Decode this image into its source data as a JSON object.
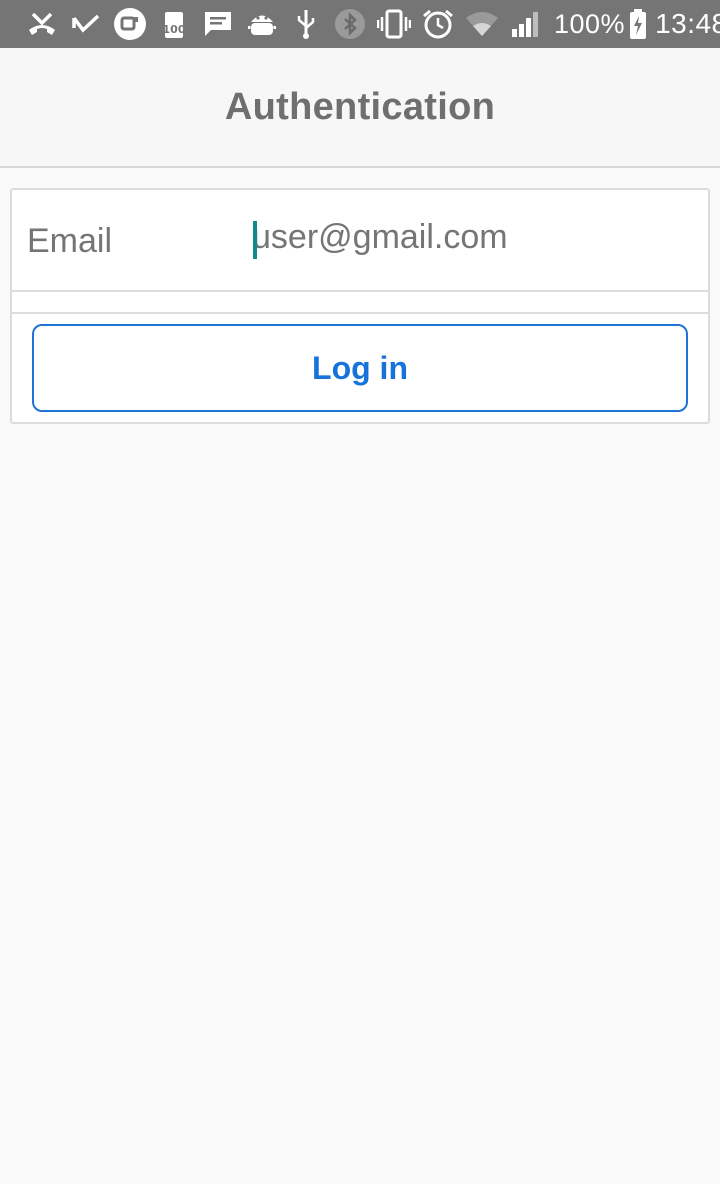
{
  "status_bar": {
    "icons": [
      "missed-call-icon",
      "call-received-icon",
      "vpn-key-icon",
      "storage-100-icon",
      "message-icon",
      "android-debug-icon",
      "usb-icon",
      "bluetooth-icon",
      "vibrate-icon",
      "alarm-icon",
      "wifi-icon",
      "cell-signal-icon"
    ],
    "battery_percent": "100%",
    "time": "13:48"
  },
  "header": {
    "title": "Authentication"
  },
  "form": {
    "email_label": "Email",
    "email_value": "user@gmail.com",
    "login_label": "Log in"
  },
  "colors": {
    "status_bar": "#757575",
    "accent": "#1773db",
    "caret": "#0e8a8a"
  }
}
